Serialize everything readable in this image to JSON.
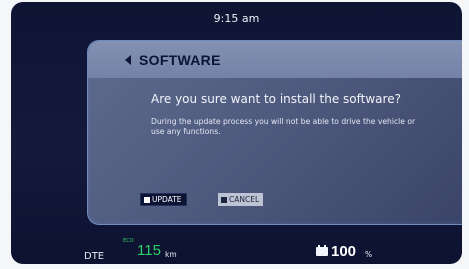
{
  "status": {
    "time": "9:15 am"
  },
  "dialog": {
    "title": "SOFTWARE",
    "question": "Are you sure want to install the software?",
    "info": "During the update process you will not be able to drive the vehicle or use any functions.",
    "update_label": "UPDATE",
    "cancel_label": "CANCEL"
  },
  "footer": {
    "dte_label": "DTE",
    "eco_label": "ECO",
    "range_value": "115",
    "range_unit": "km",
    "battery_value": "100",
    "battery_unit": "%"
  },
  "colors": {
    "eco_green": "#2ad06a",
    "background": "#0e1534",
    "dialog_header": "#7482a8"
  },
  "icons": [
    "back-arrow-icon",
    "battery-icon"
  ]
}
